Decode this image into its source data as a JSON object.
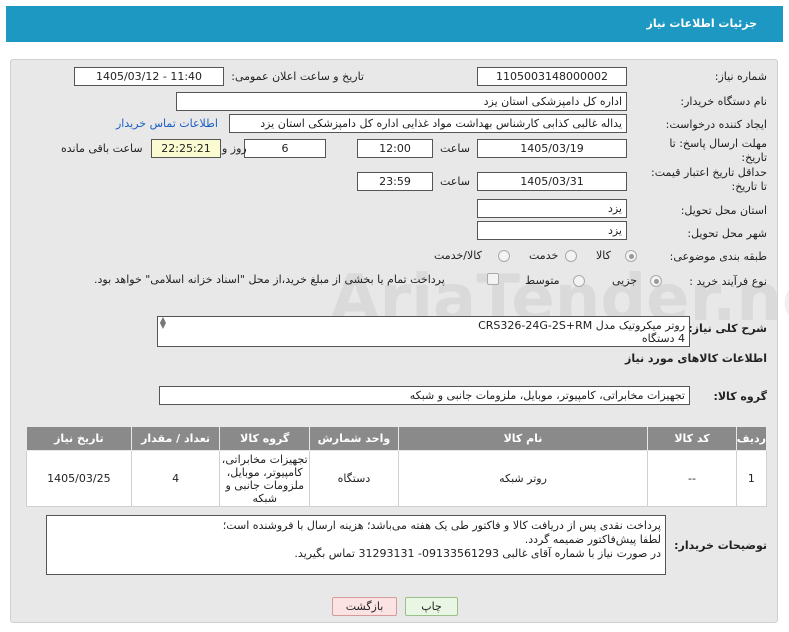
{
  "header": {
    "title": "جزئیات اطلاعات نیاز"
  },
  "form": {
    "need_number_label": "شماره نیاز:",
    "need_number": "1105003148000002",
    "announce_label": "تاریخ و ساعت اعلان عمومی:",
    "announce_value": "1405/03/12 - 11:40",
    "buyer_org_label": "نام دستگاه خریدار:",
    "buyer_org": "اداره کل دامپزشکی استان یزد",
    "creator_label": "ایجاد کننده درخواست:",
    "creator": "یداله غالبی کذابی کارشناس بهداشت مواد غذایی اداره کل دامپزشکی استان یزد",
    "contact_link": "اطلاعات تماس خریدار",
    "reply_deadline_label_1": "مهلت ارسال پاسخ: تا",
    "reply_deadline_label_2": "تاریخ:",
    "reply_date": "1405/03/19",
    "time_label": "ساعت",
    "reply_time": "12:00",
    "days": "6",
    "days_label": "روز و",
    "remaining_time": "22:25:21",
    "remaining_label": "ساعت باقی مانده",
    "price_validity_label_1": "حداقل تاریخ اعتبار قیمت:",
    "price_validity_label_2": "تا تاریخ:",
    "validity_date": "1405/03/31",
    "validity_time": "23:59",
    "province_label": "استان محل تحویل:",
    "province": "یزد",
    "city_label": "شهر محل تحویل:",
    "city": "یزد",
    "category_label": "طبقه بندی موضوعی:",
    "category_options": [
      "کالا",
      "خدمت",
      "کالا/خدمت"
    ],
    "purchase_type_label": "نوع فرآیند خرید :",
    "purchase_options": [
      "جزیی",
      "متوسط"
    ],
    "payment_note": "پرداخت تمام یا بخشی از مبلغ خرید،از محل \"اسناد خزانه اسلامی\" خواهد بود."
  },
  "summary": {
    "label": "شرح کلی نیاز:",
    "line1": "روتر میکروتیک مدل CRS326-24G-2S+RM",
    "line2": "4 دستگاه"
  },
  "goods": {
    "section_title": "اطلاعات کالاهای مورد نیاز",
    "group_label": "گروه کالا:",
    "group_value": "تجهیزات مخابراتی، کامپیوتر، موبایل، ملزومات جانبی و شبکه",
    "columns": [
      "ردیف",
      "کد کالا",
      "نام کالا",
      "واحد شمارش",
      "گروه کالا",
      "تعداد / مقدار",
      "تاریخ نیاز"
    ],
    "rows": [
      {
        "row": "1",
        "code": "--",
        "name": "روتر شبکه",
        "unit": "دستگاه",
        "group": [
          "تجهیزات مخابراتی،",
          "کامپیوتر، موبایل،",
          "ملزومات جانبی و",
          "شبکه"
        ],
        "qty": "4",
        "date": "1405/03/25"
      }
    ]
  },
  "buyer_notes": {
    "label": "توضیحات خریدار:",
    "lines": [
      "پرداخت نقدی پس از دریافت کالا و فاکتور طی  یک هفته می‌باشد؛ هزینه ارسال با فروشنده است؛",
      "لطفا پیش‌فاکتور ضمیمه گردد.",
      "در صورت نیاز با شماره آقای غالبی 09133561293- 31293131 تماس بگیرید."
    ]
  },
  "buttons": {
    "print": "چاپ",
    "back": "بازگشت"
  },
  "watermark": "AriaTender.net",
  "colors": {
    "header": "#1c98c2",
    "panel": "#e8e8e8",
    "table_header": "#8a8a8a",
    "highlight": "#fbfbd2",
    "link": "#1a5ec4"
  }
}
